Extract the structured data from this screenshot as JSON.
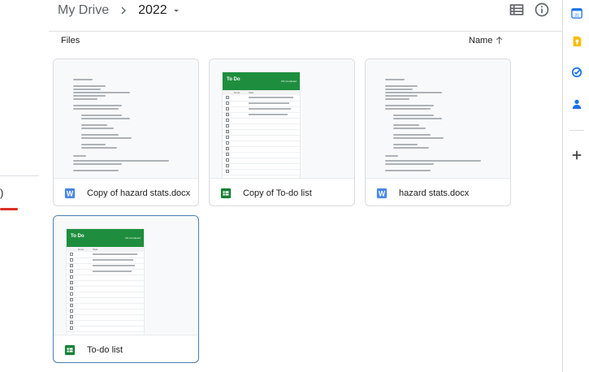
{
  "breadcrumb": {
    "root": "My Drive",
    "current": "2022"
  },
  "left_panel": {
    "paren_text": ")"
  },
  "files_header": {
    "label": "Files",
    "sort_label": "Name"
  },
  "files": [
    {
      "name": "Copy of hazard stats.docx",
      "type": "word",
      "selected": false
    },
    {
      "name": "Copy of To-do list",
      "type": "sheets",
      "selected": false
    },
    {
      "name": "hazard stats.docx",
      "type": "word",
      "selected": false
    },
    {
      "name": "To-do list",
      "type": "sheets",
      "selected": true
    }
  ],
  "sheet_thumb": {
    "title": "To Do",
    "tag": "0/4 completed",
    "col_done": "Done",
    "col_task": "Task"
  },
  "icons": {
    "list_view": "list-view-icon",
    "info": "info-icon",
    "calendar": "calendar-icon",
    "keep": "keep-icon",
    "tasks": "tasks-icon",
    "contacts": "contacts-icon",
    "add": "plus-icon"
  },
  "colors": {
    "word": "#4a86e8",
    "sheets": "#188038",
    "selected_border": "#4a7fb1",
    "accent_red": "#d93025"
  }
}
